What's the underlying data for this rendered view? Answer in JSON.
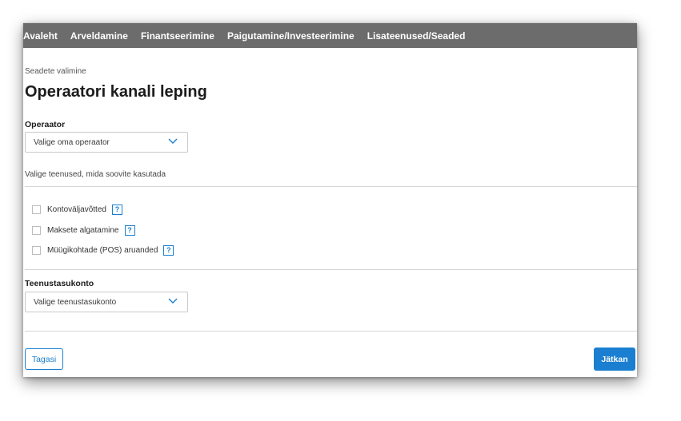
{
  "nav": {
    "items": [
      {
        "label": "Avaleht"
      },
      {
        "label": "Arveldamine"
      },
      {
        "label": "Finantseerimine"
      },
      {
        "label": "Paigutamine/Investeerimine"
      },
      {
        "label": "Lisateenused/Seaded"
      }
    ]
  },
  "breadcrumb": "Seadete valimine",
  "title": "Operaatori kanali leping",
  "operator": {
    "label": "Operaator",
    "placeholder": "Valige oma operaator"
  },
  "services": {
    "hint": "Valige teenused, mida soovite kasutada",
    "items": [
      {
        "label": "Kontoväljavõtted",
        "checked": false,
        "help": "?"
      },
      {
        "label": "Maksete algatamine",
        "checked": false,
        "help": "?"
      },
      {
        "label": "Müügikohtade (POS) aruanded",
        "checked": false,
        "help": "?"
      }
    ]
  },
  "fee_account": {
    "label": "Teenustasukonto",
    "placeholder": "Valige teenustasukonto"
  },
  "buttons": {
    "back": "Tagasi",
    "next": "Jätkan"
  },
  "colors": {
    "nav_bg": "#6c6c6c",
    "accent": "#1a7fd0"
  }
}
